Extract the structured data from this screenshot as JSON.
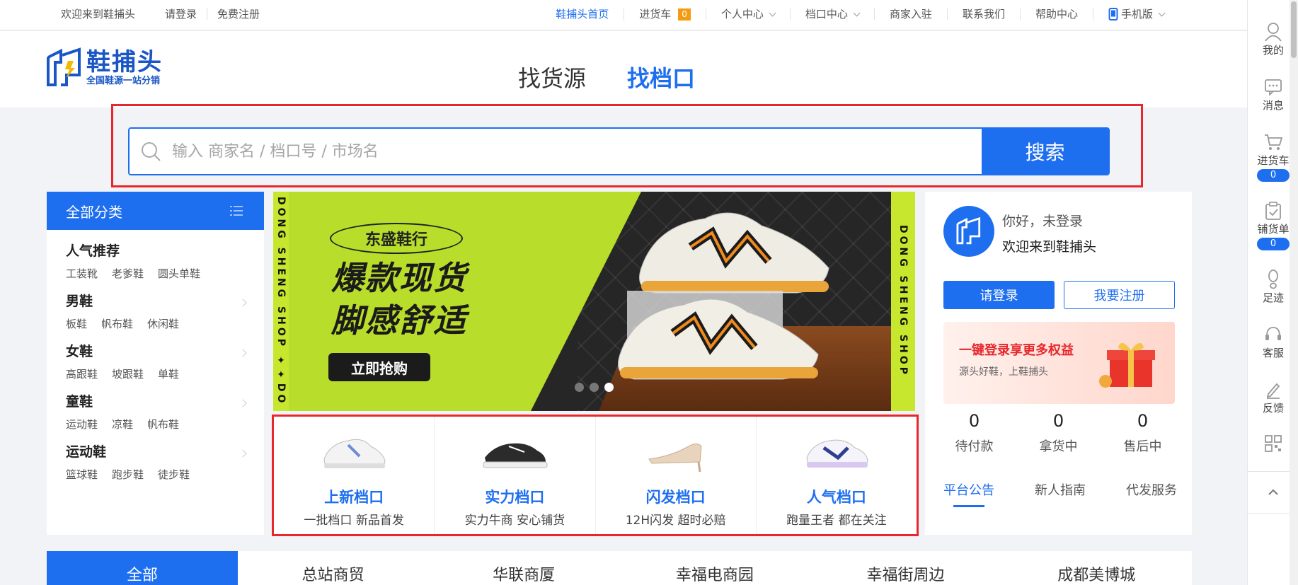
{
  "topbar": {
    "welcome": "欢迎来到鞋捕头",
    "login": "请登录",
    "register": "免费注册",
    "home": "鞋捕头首页",
    "cart": "进货车",
    "cart_count": "0",
    "personal": "个人中心",
    "stall": "档口中心",
    "merchant": "商家入驻",
    "contact": "联系我们",
    "help": "帮助中心",
    "mobile": "手机版"
  },
  "header": {
    "logo_title": "鞋捕头",
    "logo_subtitle": "全国鞋源一站分销",
    "tab_goods": "找货源",
    "tab_stall": "找档口"
  },
  "search": {
    "placeholder": "输入 商家名 / 档口号 / 市场名",
    "button": "搜索"
  },
  "category": {
    "title": "全部分类",
    "groups": [
      {
        "title": "人气推荐",
        "items": [
          "工装靴",
          "老爹鞋",
          "圆头单鞋"
        ]
      },
      {
        "title": "男鞋",
        "items": [
          "板鞋",
          "帆布鞋",
          "休闲鞋"
        ]
      },
      {
        "title": "女鞋",
        "items": [
          "高跟鞋",
          "坡跟鞋",
          "单鞋"
        ]
      },
      {
        "title": "童鞋",
        "items": [
          "运动鞋",
          "凉鞋",
          "帆布鞋"
        ]
      },
      {
        "title": "运动鞋",
        "items": [
          "篮球鞋",
          "跑步鞋",
          "徒步鞋"
        ]
      }
    ]
  },
  "banner": {
    "brand": "东盛鞋行",
    "line1": "爆款现货",
    "line2": "脚感舒适",
    "cta": "立即抢购",
    "side_text": "DONG SHENG SHOP ✦✦DO",
    "side_text_right": "DONG SHENG SHOP",
    "active_dot": 3
  },
  "quick": [
    {
      "title": "上新档口",
      "sub": "一批档口 新品首发"
    },
    {
      "title": "实力档口",
      "sub": "实力牛商 安心铺货"
    },
    {
      "title": "闪发档口",
      "sub": "12H闪发 超时必赔"
    },
    {
      "title": "人气档口",
      "sub": "跑量王者 都在关注"
    }
  ],
  "user": {
    "hello": "你好，未登录",
    "welcome": "欢迎来到鞋捕头",
    "login_btn": "请登录",
    "register_btn": "我要注册",
    "promo_title": "一键登录享更多权益",
    "promo_sub": "源头好鞋，上鞋捕头",
    "stats": [
      {
        "value": "0",
        "label": "待付款"
      },
      {
        "value": "0",
        "label": "拿货中"
      },
      {
        "value": "0",
        "label": "售后中"
      }
    ],
    "tabs": [
      "平台公告",
      "新人指南",
      "代发服务"
    ]
  },
  "markets": [
    "全部",
    "总站商贸",
    "华联商厦",
    "幸福电商园",
    "幸福街周边",
    "成都美博城"
  ],
  "sidebar": {
    "mine": "我的",
    "message": "消息",
    "cart": "进货车",
    "cart_count": "0",
    "stock": "铺货单",
    "stock_count": "0",
    "footprint": "足迹",
    "service": "客服",
    "feedback": "反馈"
  }
}
